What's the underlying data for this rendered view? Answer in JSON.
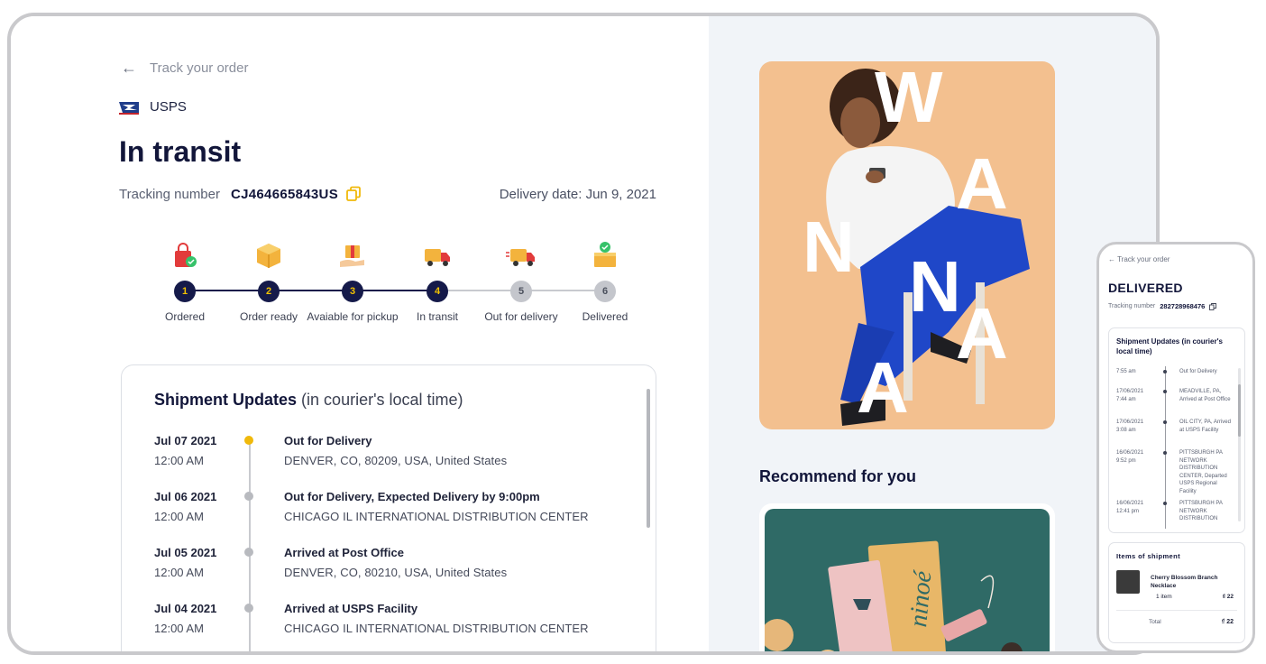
{
  "header": {
    "back_label": "Track your order",
    "carrier": "USPS",
    "status": "In transit",
    "tracking_label": "Tracking number",
    "tracking_number": "CJ464665843US",
    "delivery_date": "Delivery date: Jun 9, 2021"
  },
  "progress": {
    "current_step": 4,
    "steps": [
      {
        "number": "1",
        "label": "Ordered",
        "icon": "shopping-bag-check-icon"
      },
      {
        "number": "2",
        "label": "Order ready",
        "icon": "package-box-icon"
      },
      {
        "number": "3",
        "label": "Avaiable for pickup",
        "icon": "box-on-hand-icon"
      },
      {
        "number": "4",
        "label": "In transit",
        "icon": "delivery-truck-icon"
      },
      {
        "number": "5",
        "label": "Out for delivery",
        "icon": "delivery-truck-fast-icon"
      },
      {
        "number": "6",
        "label": "Delivered",
        "icon": "box-delivered-check-icon"
      }
    ]
  },
  "updates": {
    "title": "Shipment Updates",
    "subtitle": "(in courier's local time)",
    "events": [
      {
        "date": "Jul 07 2021",
        "time": "12:00 AM",
        "status": "Out for Delivery",
        "location": "DENVER, CO, 80209, USA, United States",
        "active": true
      },
      {
        "date": "Jul 06 2021",
        "time": "12:00 AM",
        "status": "Out for Delivery, Expected Delivery by 9:00pm",
        "location": "CHICAGO IL INTERNATIONAL DISTRIBUTION CENTER",
        "active": false
      },
      {
        "date": "Jul 05 2021",
        "time": "12:00 AM",
        "status": "Arrived at Post Office",
        "location": "DENVER, CO, 80210, USA, United States",
        "active": false
      },
      {
        "date": "Jul 04 2021",
        "time": "12:00 AM",
        "status": "Arrived at USPS Facility",
        "location": "CHICAGO IL INTERNATIONAL DISTRIBUTION CENTER",
        "active": false
      }
    ]
  },
  "promo": {
    "letters": [
      "W",
      "A",
      "N",
      "N",
      "A",
      "A"
    ],
    "recommend_title": "Recommend for you",
    "product_brand": "ninoé"
  },
  "phone": {
    "back_label": "Track your order",
    "status": "DELIVERED",
    "tracking_label": "Tracking number",
    "tracking_number": "282728968476",
    "updates_title": "Shipment Updates (in courier's local time)",
    "events": [
      {
        "date": "",
        "time": "7:55 am",
        "text": "Out for Delivery"
      },
      {
        "date": "17/06/2021",
        "time": "7:44 am",
        "text": "MEADVILLE, PA, Arrived at Post Office"
      },
      {
        "date": "17/06/2021",
        "time": "3:08 am",
        "text": "OIL CITY, PA, Arrived at USPS Facility"
      },
      {
        "date": "16/06/2021",
        "time": "9:52 pm",
        "text": "PITTSBURGH PA NETWORK DISTRIBUTION CENTER, Departed USPS Regional Facility"
      },
      {
        "date": "16/06/2021",
        "time": "12:41 pm",
        "text": "PITTSBURGH PA NETWORK DISTRIBUTION"
      }
    ],
    "items_title": "Items of shipment",
    "item_name": "Cherry Blossom Branch Necklace",
    "item_qty": "1 item",
    "item_price": "₫ 22",
    "total_label": "Total",
    "total_value": "₫ 22"
  },
  "colors": {
    "navy": "#151a4a",
    "accent_yellow": "#f0b90b",
    "promo_bg": "#f3c08f",
    "product_bg": "#2f6a66"
  }
}
